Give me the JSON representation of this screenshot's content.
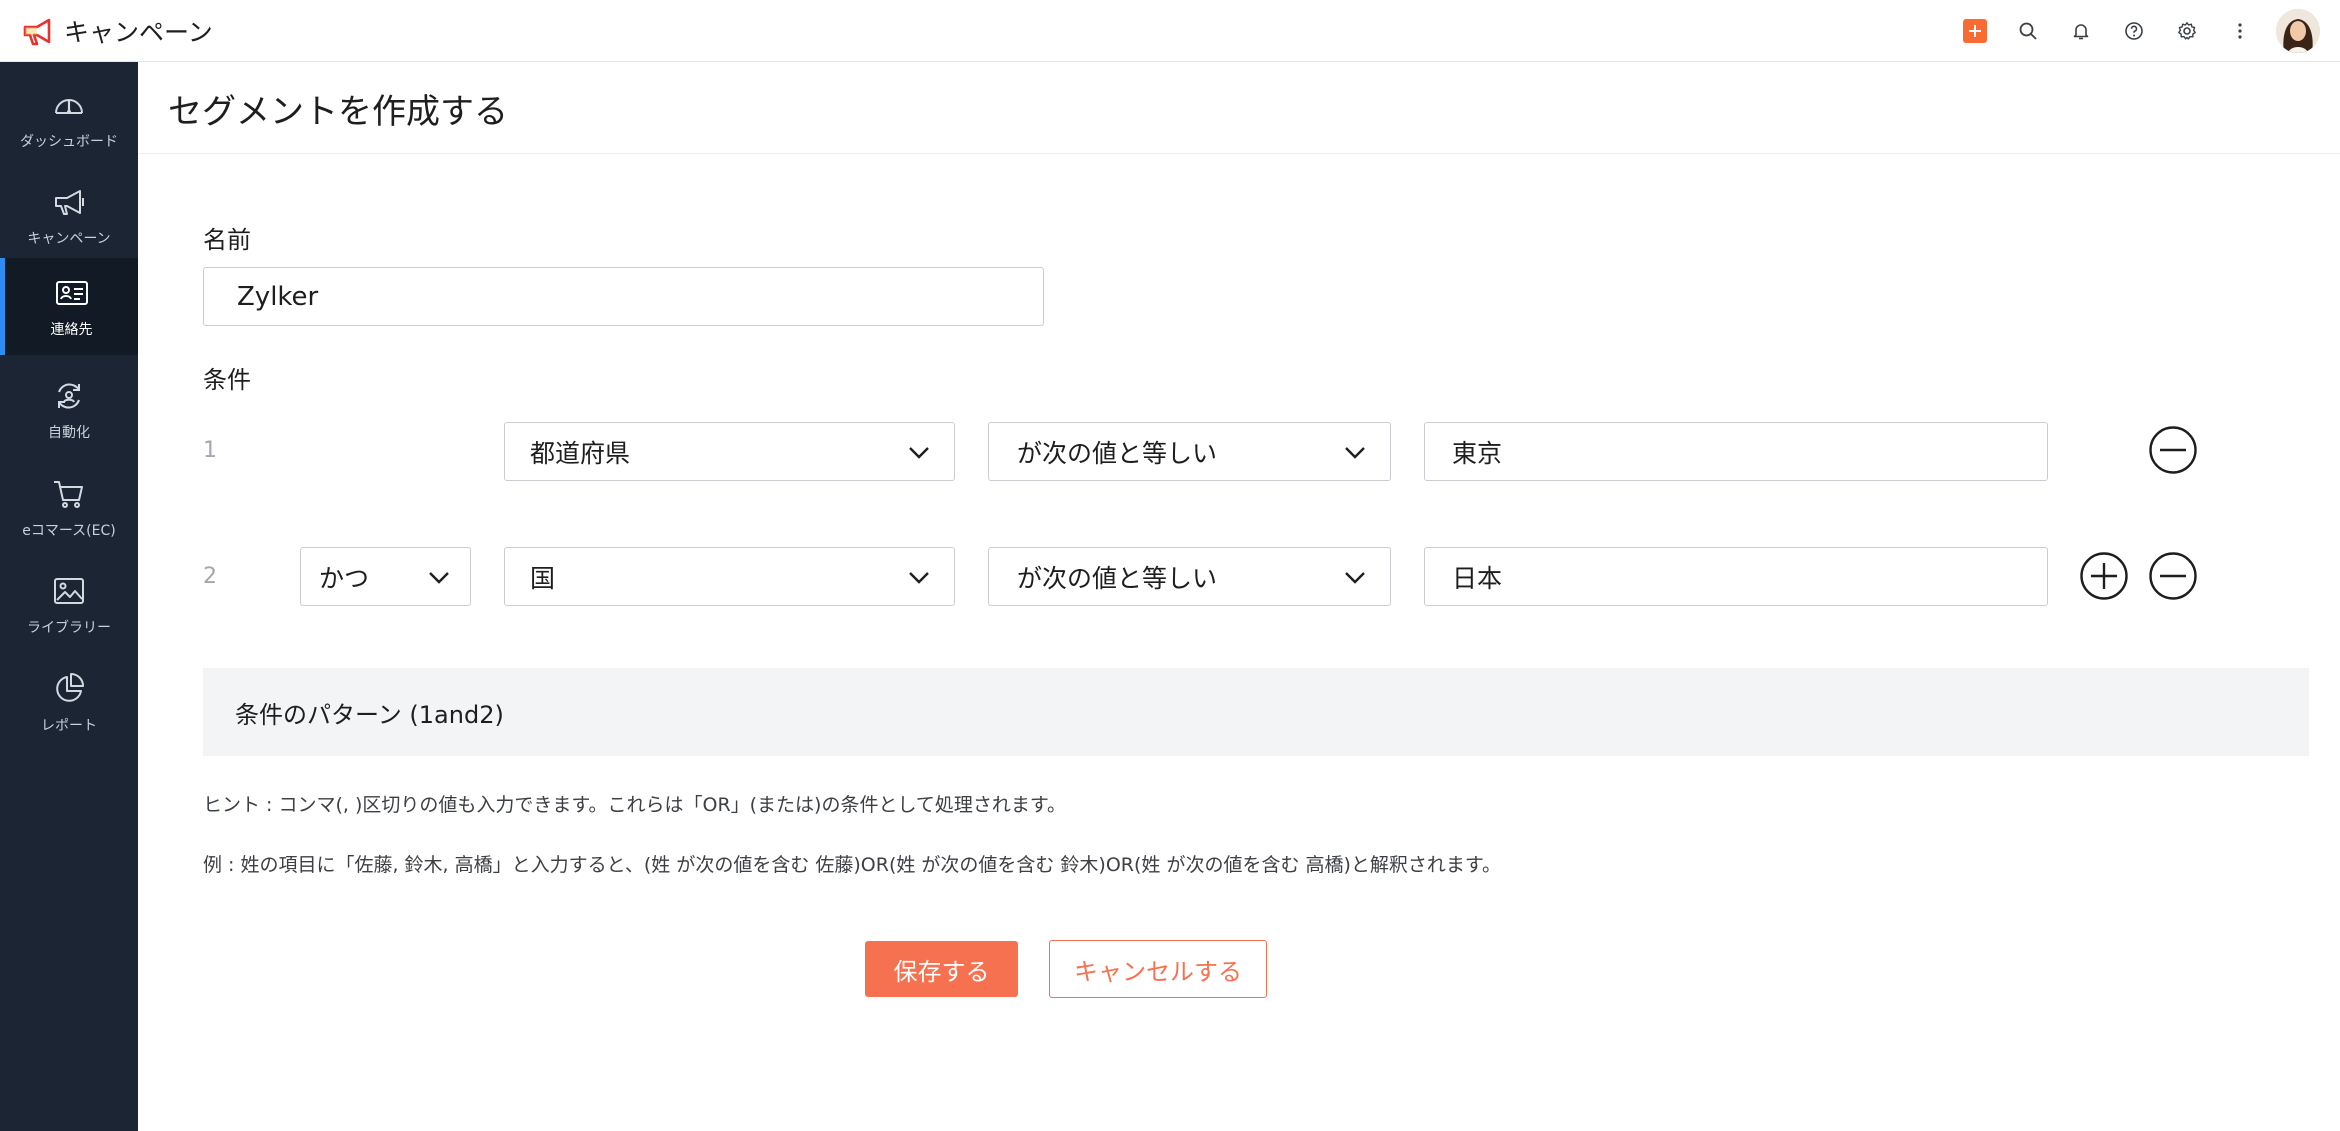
{
  "app": {
    "title": "キャンペーン"
  },
  "header_icons": [
    "plus-icon",
    "search-icon",
    "bell-icon",
    "help-icon",
    "gear-icon",
    "more-vertical-icon"
  ],
  "colors": {
    "accent": "#f5714f",
    "sidebar_bg": "#1b2533",
    "active_indicator": "#2f8cf0"
  },
  "sidebar": {
    "items": [
      {
        "label": "ダッシュボード",
        "icon": "dashboard-gauge-icon",
        "active": false
      },
      {
        "label": "キャンペーン",
        "icon": "megaphone-icon",
        "active": false
      },
      {
        "label": "連絡先",
        "icon": "contact-card-icon",
        "active": true
      },
      {
        "label": "自動化",
        "icon": "automation-icon",
        "active": false
      },
      {
        "label": "eコマース(EC)",
        "icon": "cart-icon",
        "active": false
      },
      {
        "label": "ライブラリー",
        "icon": "image-library-icon",
        "active": false
      },
      {
        "label": "レポート",
        "icon": "pie-chart-icon",
        "active": false
      }
    ]
  },
  "page": {
    "title": "セグメントを作成する"
  },
  "form": {
    "name_label": "名前",
    "name_value": "Zylker",
    "conditions_label": "条件",
    "conditions": [
      {
        "number": "1",
        "field": "都道府県",
        "operator": "が次の値と等しい",
        "value": "東京"
      },
      {
        "number": "2",
        "join": "かつ",
        "field": "国",
        "operator": "が次の値と等しい",
        "value": "日本"
      }
    ],
    "pattern": "条件のパターン (1and2)",
    "hint1": "ヒント : コンマ(, )区切りの値も入力できます。これらは「OR」(または)の条件として処理されます。",
    "hint2": "例 : 姓の項目に「佐藤, 鈴木, 高橋」と入力すると、(姓 が次の値を含む 佐藤)OR(姓 が次の値を含む 鈴木)OR(姓 が次の値を含む 高橋)と解釈されます。",
    "save_label": "保存する",
    "cancel_label": "キャンセルする"
  }
}
